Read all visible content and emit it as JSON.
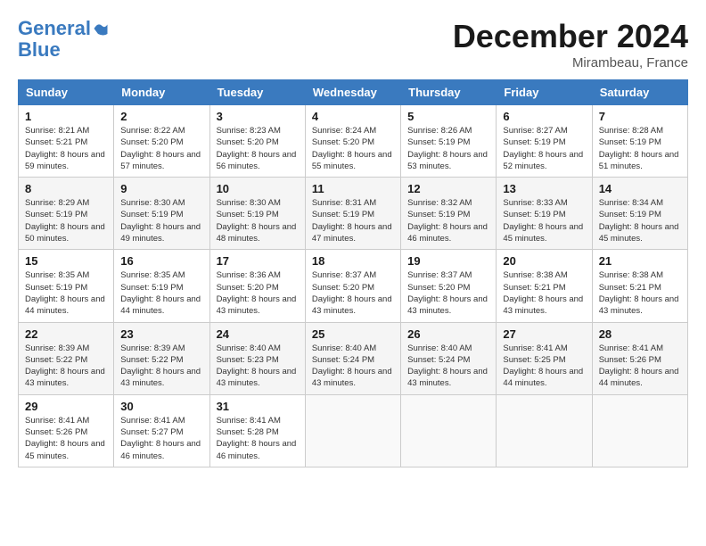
{
  "logo": {
    "line1": "General",
    "line2": "Blue"
  },
  "title": "December 2024",
  "subtitle": "Mirambeau, France",
  "days_header": [
    "Sunday",
    "Monday",
    "Tuesday",
    "Wednesday",
    "Thursday",
    "Friday",
    "Saturday"
  ],
  "weeks": [
    [
      {
        "day": "1",
        "sunrise": "8:21 AM",
        "sunset": "5:21 PM",
        "daylight": "8 hours and 59 minutes."
      },
      {
        "day": "2",
        "sunrise": "8:22 AM",
        "sunset": "5:20 PM",
        "daylight": "8 hours and 57 minutes."
      },
      {
        "day": "3",
        "sunrise": "8:23 AM",
        "sunset": "5:20 PM",
        "daylight": "8 hours and 56 minutes."
      },
      {
        "day": "4",
        "sunrise": "8:24 AM",
        "sunset": "5:20 PM",
        "daylight": "8 hours and 55 minutes."
      },
      {
        "day": "5",
        "sunrise": "8:26 AM",
        "sunset": "5:19 PM",
        "daylight": "8 hours and 53 minutes."
      },
      {
        "day": "6",
        "sunrise": "8:27 AM",
        "sunset": "5:19 PM",
        "daylight": "8 hours and 52 minutes."
      },
      {
        "day": "7",
        "sunrise": "8:28 AM",
        "sunset": "5:19 PM",
        "daylight": "8 hours and 51 minutes."
      }
    ],
    [
      {
        "day": "8",
        "sunrise": "8:29 AM",
        "sunset": "5:19 PM",
        "daylight": "8 hours and 50 minutes."
      },
      {
        "day": "9",
        "sunrise": "8:30 AM",
        "sunset": "5:19 PM",
        "daylight": "8 hours and 49 minutes."
      },
      {
        "day": "10",
        "sunrise": "8:30 AM",
        "sunset": "5:19 PM",
        "daylight": "8 hours and 48 minutes."
      },
      {
        "day": "11",
        "sunrise": "8:31 AM",
        "sunset": "5:19 PM",
        "daylight": "8 hours and 47 minutes."
      },
      {
        "day": "12",
        "sunrise": "8:32 AM",
        "sunset": "5:19 PM",
        "daylight": "8 hours and 46 minutes."
      },
      {
        "day": "13",
        "sunrise": "8:33 AM",
        "sunset": "5:19 PM",
        "daylight": "8 hours and 45 minutes."
      },
      {
        "day": "14",
        "sunrise": "8:34 AM",
        "sunset": "5:19 PM",
        "daylight": "8 hours and 45 minutes."
      }
    ],
    [
      {
        "day": "15",
        "sunrise": "8:35 AM",
        "sunset": "5:19 PM",
        "daylight": "8 hours and 44 minutes."
      },
      {
        "day": "16",
        "sunrise": "8:35 AM",
        "sunset": "5:19 PM",
        "daylight": "8 hours and 44 minutes."
      },
      {
        "day": "17",
        "sunrise": "8:36 AM",
        "sunset": "5:20 PM",
        "daylight": "8 hours and 43 minutes."
      },
      {
        "day": "18",
        "sunrise": "8:37 AM",
        "sunset": "5:20 PM",
        "daylight": "8 hours and 43 minutes."
      },
      {
        "day": "19",
        "sunrise": "8:37 AM",
        "sunset": "5:20 PM",
        "daylight": "8 hours and 43 minutes."
      },
      {
        "day": "20",
        "sunrise": "8:38 AM",
        "sunset": "5:21 PM",
        "daylight": "8 hours and 43 minutes."
      },
      {
        "day": "21",
        "sunrise": "8:38 AM",
        "sunset": "5:21 PM",
        "daylight": "8 hours and 43 minutes."
      }
    ],
    [
      {
        "day": "22",
        "sunrise": "8:39 AM",
        "sunset": "5:22 PM",
        "daylight": "8 hours and 43 minutes."
      },
      {
        "day": "23",
        "sunrise": "8:39 AM",
        "sunset": "5:22 PM",
        "daylight": "8 hours and 43 minutes."
      },
      {
        "day": "24",
        "sunrise": "8:40 AM",
        "sunset": "5:23 PM",
        "daylight": "8 hours and 43 minutes."
      },
      {
        "day": "25",
        "sunrise": "8:40 AM",
        "sunset": "5:24 PM",
        "daylight": "8 hours and 43 minutes."
      },
      {
        "day": "26",
        "sunrise": "8:40 AM",
        "sunset": "5:24 PM",
        "daylight": "8 hours and 43 minutes."
      },
      {
        "day": "27",
        "sunrise": "8:41 AM",
        "sunset": "5:25 PM",
        "daylight": "8 hours and 44 minutes."
      },
      {
        "day": "28",
        "sunrise": "8:41 AM",
        "sunset": "5:26 PM",
        "daylight": "8 hours and 44 minutes."
      }
    ],
    [
      {
        "day": "29",
        "sunrise": "8:41 AM",
        "sunset": "5:26 PM",
        "daylight": "8 hours and 45 minutes."
      },
      {
        "day": "30",
        "sunrise": "8:41 AM",
        "sunset": "5:27 PM",
        "daylight": "8 hours and 46 minutes."
      },
      {
        "day": "31",
        "sunrise": "8:41 AM",
        "sunset": "5:28 PM",
        "daylight": "8 hours and 46 minutes."
      },
      null,
      null,
      null,
      null
    ]
  ]
}
